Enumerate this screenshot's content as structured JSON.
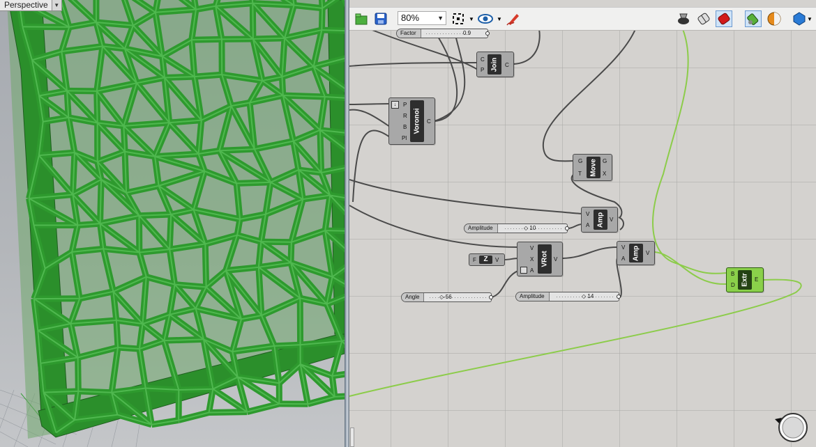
{
  "viewport": {
    "title": "Perspective",
    "menu_icon": "dropdown-arrow-icon",
    "object_color": "#2a8a2a"
  },
  "toolbar": {
    "zoom": "80%",
    "icons": [
      "open-file-icon",
      "save-icon",
      "zoom-extents-icon",
      "preview-eye-icon",
      "sketch-pen-icon",
      "preview-shaded-icon",
      "wire-display-icon",
      "selected-preview-icon",
      "bake-icon",
      "material-icon",
      "mesh-preview-icon"
    ]
  },
  "components": {
    "factor": {
      "label": "Factor",
      "value": "0.9"
    },
    "join": {
      "name": "Join",
      "inputs": [
        "C",
        "P"
      ],
      "outputs": [
        "C"
      ]
    },
    "voronoi": {
      "name": "Voronoi",
      "inputs": [
        "P",
        "R",
        "B",
        "Pl"
      ],
      "outputs": [
        "C"
      ]
    },
    "move": {
      "name": "Move",
      "inputs": [
        "G",
        "T"
      ],
      "outputs": [
        "G",
        "X"
      ]
    },
    "amp1": {
      "name": "Amp",
      "inputs": [
        "V",
        "A"
      ],
      "outputs": [
        "V"
      ]
    },
    "amplitude1": {
      "label": "Amplitude",
      "value": "10"
    },
    "z": {
      "input": "F",
      "name": "Z",
      "output": "V"
    },
    "vrot": {
      "name": "VRot",
      "inputs": [
        "V",
        "X",
        "A"
      ],
      "outputs": [
        "V"
      ]
    },
    "amp2": {
      "name": "Amp",
      "inputs": [
        "V",
        "A"
      ],
      "outputs": [
        "V"
      ]
    },
    "angle": {
      "label": "Angle",
      "value": "-56"
    },
    "amplitude2": {
      "label": "Amplitude",
      "value": "14"
    },
    "extr": {
      "name": "Extr",
      "inputs": [
        "B",
        "D"
      ],
      "outputs": [
        "E"
      ]
    }
  },
  "colors": {
    "wire": "#4a4a4a",
    "selected_wire": "#8ccc4a",
    "selected_component": "#8ad04a"
  }
}
